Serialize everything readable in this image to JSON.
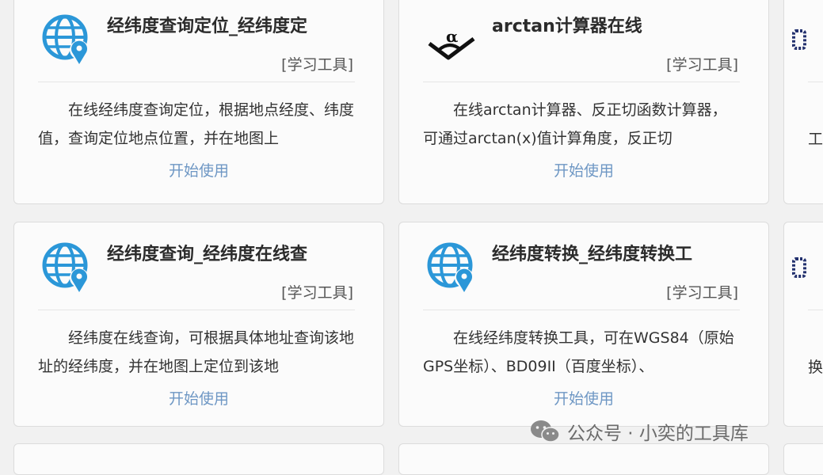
{
  "tag_label": "[学习工具]",
  "start_label": "开始使用",
  "colors": {
    "globe": "#2b97d8",
    "link": "#6e97c4"
  },
  "cards": [
    {
      "icon": "globe-location-icon",
      "title": "经纬度查询定位_经纬度定",
      "desc": "在线经纬度查询定位，根据地点经度、纬度值，查询定位地点位置，并在地图上"
    },
    {
      "icon": "arctan-icon",
      "title": "arctan计算器在线",
      "desc": "在线arctan计算器、反正切函数计算器，可通过arctan(x)值计算角度，反正切"
    },
    {
      "icon": "globe-location-icon",
      "title": "经纬度查询_经纬度在线查",
      "desc": "经纬度在线查询，可根据具体地址查询该地址的经纬度，并在地图上定位到该地"
    },
    {
      "icon": "globe-location-icon",
      "title": "经纬度转换_经纬度转换工",
      "desc": "在线经纬度转换工具，可在WGS84（原始GPS坐标）、BD09II（百度坐标）、"
    }
  ],
  "partial_cards": [
    {
      "fragment": "工"
    },
    {
      "fragment": "换"
    }
  ],
  "arctan_symbol": "α",
  "watermark": {
    "text": "公众号 · 小奕的工具库",
    "icon": "wechat-icon"
  }
}
